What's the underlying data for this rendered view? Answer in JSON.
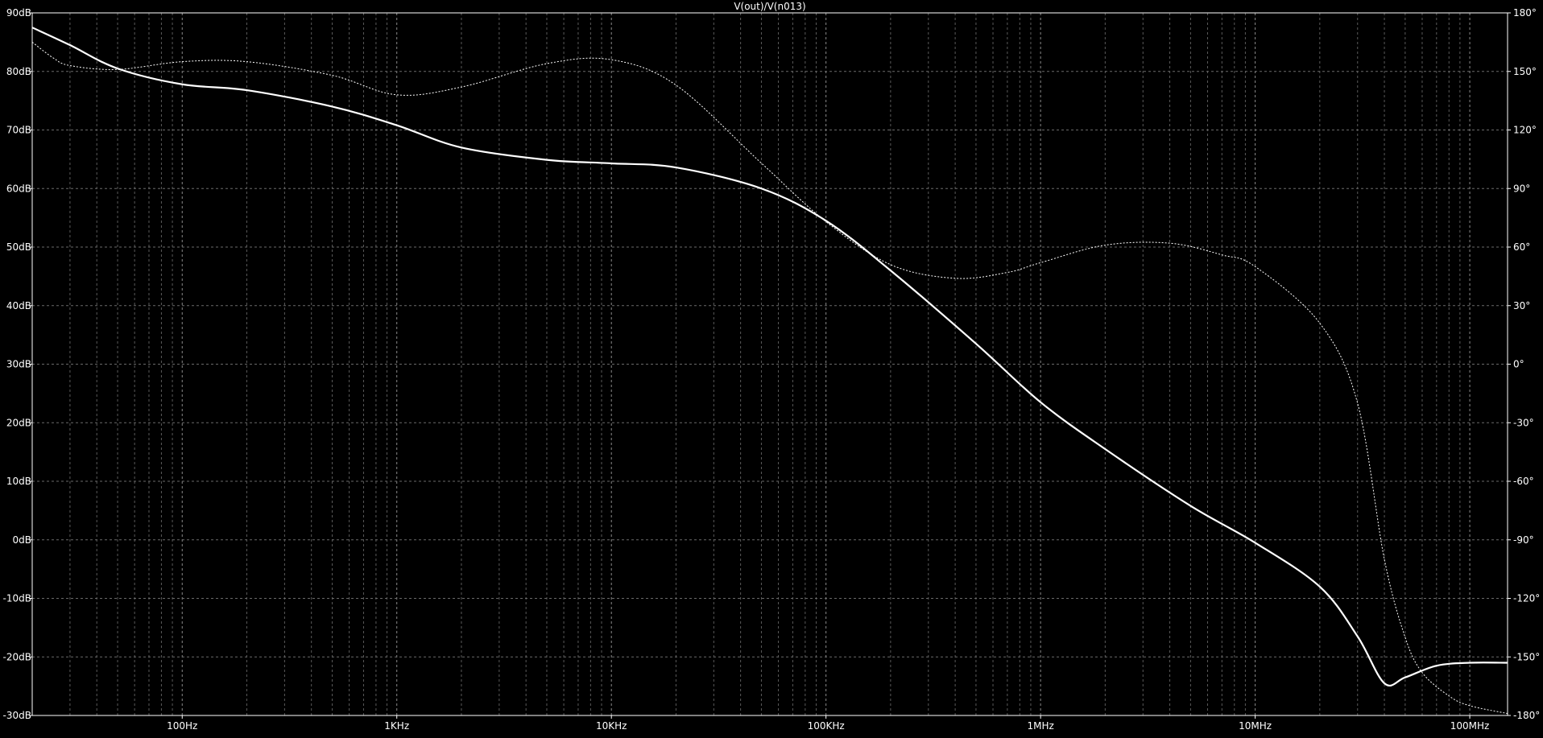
{
  "chart_data": {
    "type": "line",
    "title": "V(out)/V(n013)",
    "x_scale": "log",
    "xlim": [
      20,
      150000000
    ],
    "ylim_left": [
      -30,
      90
    ],
    "ylim_right": [
      -180,
      180
    ],
    "grid": true,
    "x_ticks": [
      {
        "value": 100,
        "label": "100Hz"
      },
      {
        "value": 1000,
        "label": "1KHz"
      },
      {
        "value": 10000,
        "label": "10KHz"
      },
      {
        "value": 100000,
        "label": "100KHz"
      },
      {
        "value": 1000000,
        "label": "1MHz"
      },
      {
        "value": 10000000,
        "label": "10MHz"
      },
      {
        "value": 100000000,
        "label": "100MHz"
      }
    ],
    "y_left_ticks": [
      {
        "value": 90,
        "label": "90dB"
      },
      {
        "value": 80,
        "label": "80dB"
      },
      {
        "value": 70,
        "label": "70dB"
      },
      {
        "value": 60,
        "label": "60dB"
      },
      {
        "value": 50,
        "label": "50dB"
      },
      {
        "value": 40,
        "label": "40dB"
      },
      {
        "value": 30,
        "label": "30dB"
      },
      {
        "value": 20,
        "label": "20dB"
      },
      {
        "value": 10,
        "label": "10dB"
      },
      {
        "value": 0,
        "label": "0dB"
      },
      {
        "value": -10,
        "label": "-10dB"
      },
      {
        "value": -20,
        "label": "-20dB"
      },
      {
        "value": -30,
        "label": "-30dB"
      }
    ],
    "y_right_ticks": [
      {
        "value": 180,
        "label": "180°"
      },
      {
        "value": 150,
        "label": "150°"
      },
      {
        "value": 120,
        "label": "120°"
      },
      {
        "value": 90,
        "label": "90°"
      },
      {
        "value": 60,
        "label": "60°"
      },
      {
        "value": 30,
        "label": "30°"
      },
      {
        "value": 0,
        "label": "0°"
      },
      {
        "value": -30,
        "label": "-30°"
      },
      {
        "value": -60,
        "label": "-60°"
      },
      {
        "value": -90,
        "label": "-90°"
      },
      {
        "value": -120,
        "label": "-120°"
      },
      {
        "value": -150,
        "label": "-150°"
      },
      {
        "value": -180,
        "label": "-180°"
      }
    ],
    "series": [
      {
        "axis": "left",
        "style": "solid",
        "color": "#ffffff",
        "x": [
          20,
          30,
          50,
          100,
          200,
          500,
          1000,
          2000,
          5000,
          10000,
          20000,
          50000,
          100000,
          200000,
          500000,
          1000000,
          2000000,
          5000000,
          10000000,
          20000000,
          30000000,
          40000000,
          50000000,
          70000000,
          100000000,
          150000000
        ],
        "y": [
          87.5,
          84.5,
          80.5,
          77.8,
          76.8,
          74.0,
          70.8,
          67.0,
          64.9,
          64.3,
          63.6,
          60.0,
          54.5,
          46.0,
          33.5,
          23.5,
          15.5,
          5.8,
          -0.5,
          -8.0,
          -16.5,
          -24.5,
          -23.5,
          -21.5,
          -21.0,
          -21.0
        ]
      },
      {
        "axis": "right",
        "style": "dashed",
        "color": "#ffffff",
        "x": [
          20,
          25,
          30,
          50,
          100,
          200,
          500,
          1000,
          2000,
          5000,
          10000,
          20000,
          50000,
          100000,
          200000,
          400000,
          700000,
          1000000,
          2000000,
          4000000,
          7000000,
          10000000,
          20000000,
          30000000,
          40000000,
          50000000,
          60000000,
          80000000,
          100000000,
          150000000
        ],
        "y": [
          165,
          157,
          153,
          151,
          155,
          155,
          148,
          138,
          142,
          154,
          156,
          143,
          103,
          73,
          51,
          44,
          47,
          52,
          61,
          62,
          56,
          50,
          21,
          -20,
          -100,
          -140,
          -158,
          -170,
          -175,
          -179
        ]
      }
    ]
  }
}
